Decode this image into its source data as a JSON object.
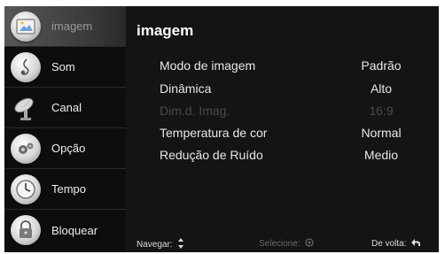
{
  "sidebar": {
    "items": [
      {
        "label": "imagem",
        "icon": "picture-icon",
        "active": true
      },
      {
        "label": "Som",
        "icon": "music-note-icon",
        "active": false
      },
      {
        "label": "Canal",
        "icon": "satellite-dish-icon",
        "active": false
      },
      {
        "label": "Opção",
        "icon": "gears-icon",
        "active": false
      },
      {
        "label": "Tempo",
        "icon": "clock-icon",
        "active": false
      },
      {
        "label": "Bloquear",
        "icon": "lock-icon",
        "active": false
      }
    ]
  },
  "main": {
    "title": "imagem",
    "settings": [
      {
        "label": "Modo de imagem",
        "value": "Padrão",
        "enabled": true
      },
      {
        "label": "Dinâmica",
        "value": "Alto",
        "enabled": true
      },
      {
        "label": "Dim.d. Imag.",
        "value": "16:9",
        "enabled": false
      },
      {
        "label": "Temperatura de cor",
        "value": "Normal",
        "enabled": true
      },
      {
        "label": "Redução de Ruído",
        "value": "Medio",
        "enabled": true
      }
    ]
  },
  "footer": {
    "navigate_label": "Navegar:",
    "select_label": "Selecione:",
    "back_label": "De volta:"
  },
  "colors": {
    "background": "#121212",
    "active_item": "#575757",
    "text": "#e8e8e8",
    "disabled_text": "#4a4a4a"
  }
}
